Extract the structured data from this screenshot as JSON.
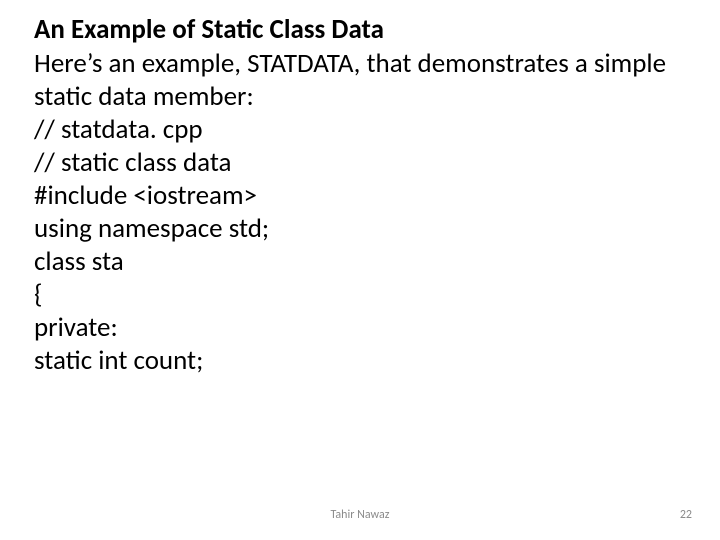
{
  "slide": {
    "title": "An Example of Static Class Data",
    "lines": [
      "Here’s an example, STATDATA, that demonstrates a simple static data member:",
      "// statdata. cpp",
      "// static class data",
      "#include <iostream>",
      "using namespace std;",
      "class sta",
      "{",
      "private:",
      "static int count;"
    ],
    "footer_author": "Tahir Nawaz",
    "page_number": "22"
  }
}
